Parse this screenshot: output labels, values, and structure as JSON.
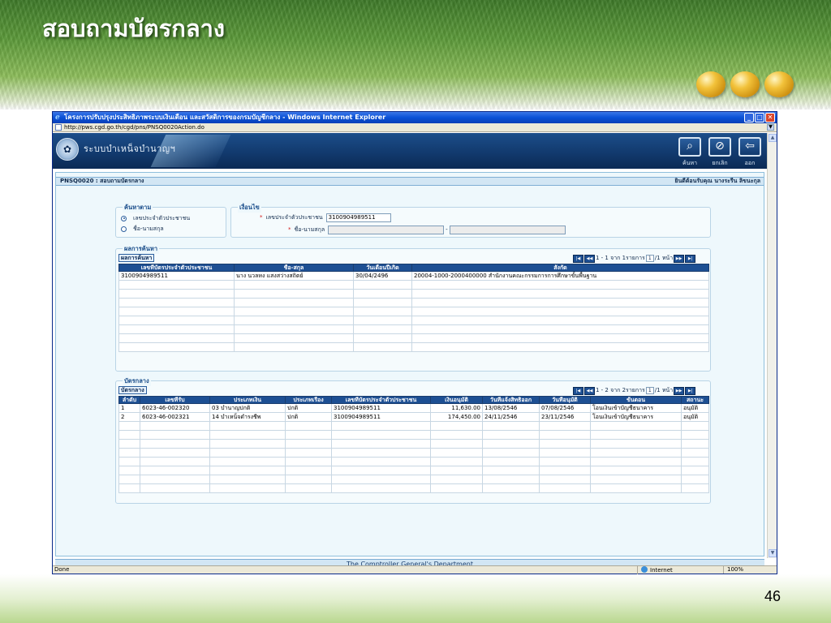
{
  "slide": {
    "title": "สอบถามบัตรกลาง",
    "page_number": "46"
  },
  "browser": {
    "window_title": "โครงการปรับปรุงประสิทธิภาพระบบเงินเดือน และสวัสดิการของกรมบัญชีกลาง - Windows Internet Explorer",
    "address": "http://pws.cgd.go.th/cgd/pns/PNSQ0020Action.do",
    "status_text": "Done",
    "zone": "Internet",
    "zoom": "100%"
  },
  "app": {
    "system_name": "ระบบบำเหน็จบำนาญฯ",
    "toolbar": [
      {
        "label": "ค้นหา"
      },
      {
        "label": "ยกเลิก"
      },
      {
        "label": "ออก"
      }
    ],
    "page_code_title": "PNSQ0020 : สอบถามบัตรกลาง",
    "welcome": "ยินดีต้อนรับคุณ นางระรีน ลิขนะกุล",
    "footer": "The Comptroller General's Department"
  },
  "search_by": {
    "legend": "ค้นหาตาม",
    "options": [
      {
        "label": "เลขประจำตัวประชาชน",
        "selected": true
      },
      {
        "label": "ชื่อ-นามสกุล",
        "selected": false
      }
    ]
  },
  "criteria": {
    "legend": "เงื่อนไข",
    "id_label": "เลขประจำตัวประชาชน",
    "id_value": "3100904989511",
    "name_label": "ชื่อ-นามสกุล",
    "name_separator": "-",
    "first_name_value": "",
    "last_name_value": ""
  },
  "results": {
    "legend": "ผลการค้นหา",
    "tab_label": "ผลการค้นหา",
    "pager_text": "1 - 1 จาก 1รายการ",
    "pager_page": "1",
    "pager_total": "/1 หน้า",
    "columns": [
      "เลขที่บัตรประจำตัวประชาชน",
      "ชื่อ-สกุล",
      "วันเดือนปีเกิด",
      "สังกัด"
    ],
    "rows": [
      [
        "3100904989511",
        "นาง นวลหง แสงสว่างสถิตย์",
        "30/04/2496",
        "20004-1000-2000400000 สำนักงานคณะกรรมการการศึกษาขั้นพื้นฐาน"
      ]
    ]
  },
  "cards": {
    "legend": "บัตรกลาง",
    "tab_label": "บัตรกลาง",
    "pager_text": "1 - 2 จาก 2รายการ",
    "pager_page": "1",
    "pager_total": "/1 หน้า",
    "columns": [
      "ลำดับ",
      "เลขที่รับ",
      "ประเภทเงิน",
      "ประเภทเรื่อง",
      "เลขที่บัตรประจำตัวประชาชน",
      "เงินอนุมัติ",
      "วันที่แจ้งสิทธิออก",
      "วันที่อนุมัติ",
      "ขั้นตอน",
      "สถานะ"
    ],
    "rows": [
      [
        "1",
        "6023-46-002320",
        "03 บำนาญปกติ",
        "ปกติ",
        "3100904989511",
        "11,630.00",
        "13/08/2546",
        "07/08/2546",
        "โอนเงินเข้าบัญชีธนาคาร",
        "อนุมัติ"
      ],
      [
        "2",
        "6023-46-002321",
        "14 บำเหน็จดำรงชีพ",
        "ปกติ",
        "3100904989511",
        "174,450.00",
        "24/11/2546",
        "23/11/2546",
        "โอนเงินเข้าบัญชีธนาคาร",
        "อนุมัติ"
      ]
    ]
  }
}
